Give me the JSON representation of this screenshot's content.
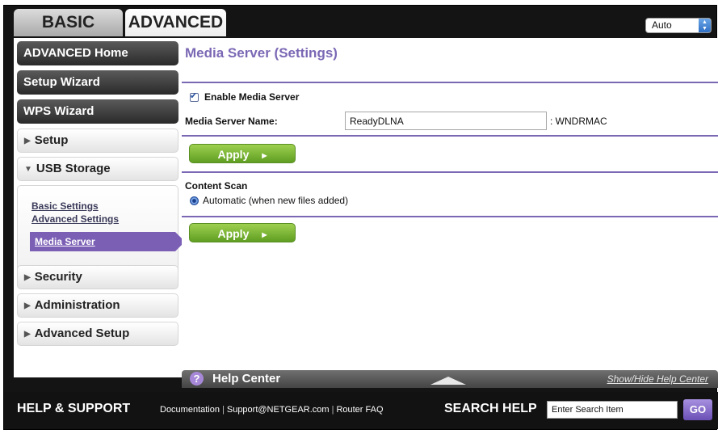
{
  "tabs": {
    "basic": "BASIC",
    "advanced": "ADVANCED"
  },
  "language": {
    "selected": "Auto"
  },
  "sidebar": {
    "advanced_home": "ADVANCED Home",
    "setup_wizard": "Setup Wizard",
    "wps_wizard": "WPS Wizard",
    "setup": "Setup",
    "usb_storage": "USB Storage",
    "usb_sub": [
      "Basic Settings",
      "Advanced Settings",
      "Media Server"
    ],
    "security": "Security",
    "administration": "Administration",
    "advanced_setup": "Advanced Setup"
  },
  "main": {
    "title": "Media Server (Settings)",
    "enable_label": "Enable Media Server",
    "enable_checked": true,
    "server_name_label": "Media Server Name:",
    "server_name_value": "ReadyDLNA",
    "server_name_suffix": ": WNDRMAC",
    "apply_label": "Apply",
    "content_scan_label": "Content Scan",
    "scan_option": "Automatic (when new files added)"
  },
  "help": {
    "title": "Help Center",
    "toggle": "Show/Hide Help Center"
  },
  "footer": {
    "support_title": "HELP & SUPPORT",
    "links": [
      "Documentation",
      "Support@NETGEAR.com",
      "Router FAQ"
    ],
    "search_title": "SEARCH HELP",
    "search_placeholder": "Enter Search Item",
    "go": "GO"
  },
  "colors": {
    "accent": "#7b68b5",
    "apply": "#7fb83a",
    "nav_dark": "#2a2a2a"
  }
}
